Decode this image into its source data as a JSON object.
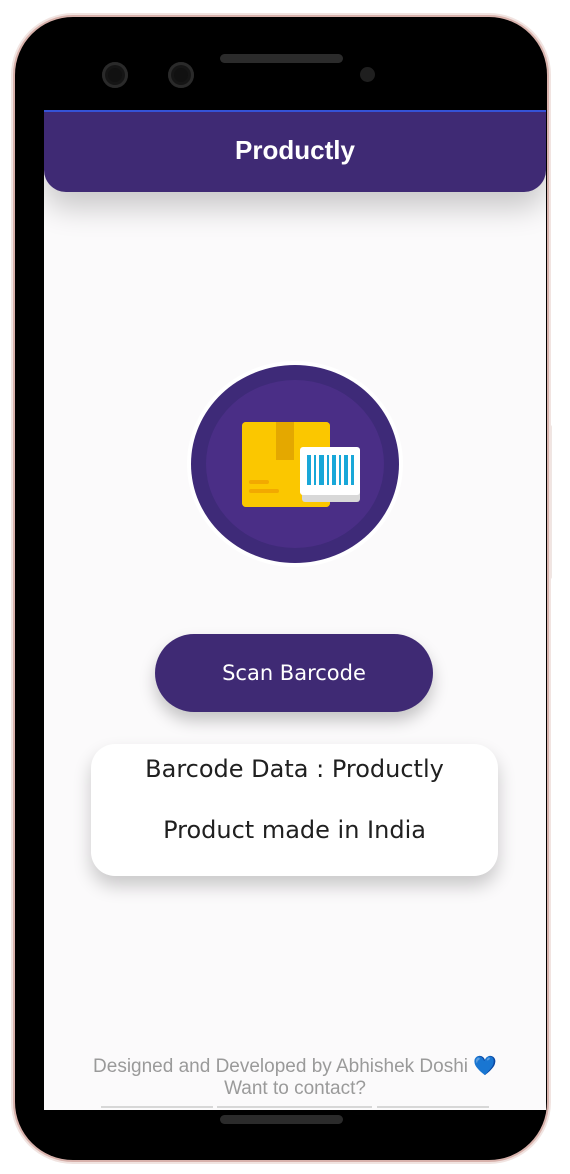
{
  "appbar": {
    "title": "Productly"
  },
  "main": {
    "logo_icon": "package-barcode-icon",
    "scan_button_label": "Scan Barcode"
  },
  "result": {
    "line1": "Barcode Data : Productly",
    "line2": "Product made in India"
  },
  "footer": {
    "credit": "Designed and Developed by Abhishek Doshi",
    "heart": "💙",
    "contact": "Want to contact?"
  },
  "colors": {
    "primary": "#3f2a74",
    "background": "#fbfafb",
    "button_text": "#ffffff",
    "footer_text": "#9a9a9a",
    "heart": "#3486e6"
  }
}
